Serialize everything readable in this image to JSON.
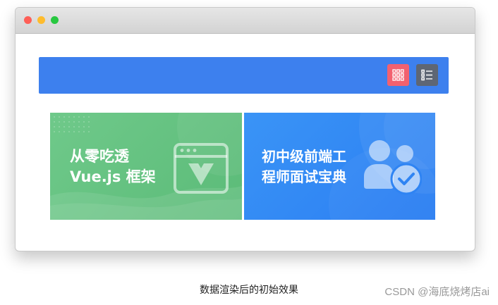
{
  "window": {
    "controls": [
      "close",
      "minimize",
      "maximize"
    ]
  },
  "toolbar": {
    "background": "#3d80ee",
    "buttons": [
      {
        "icon": "grid-view-icon",
        "color": "#f2616f"
      },
      {
        "icon": "list-view-icon",
        "color": "#5e6674"
      }
    ]
  },
  "cards": [
    {
      "title": "从零吃透 Vue.js 框架",
      "icon": "vue-window-icon",
      "color": "#6fc98a"
    },
    {
      "title": "初中级前端工程师面试宝典",
      "icon": "users-check-icon",
      "color": "#3a94f6"
    }
  ],
  "caption": "数据渲染后的初始效果",
  "watermark": "CSDN @海底烧烤店ai"
}
